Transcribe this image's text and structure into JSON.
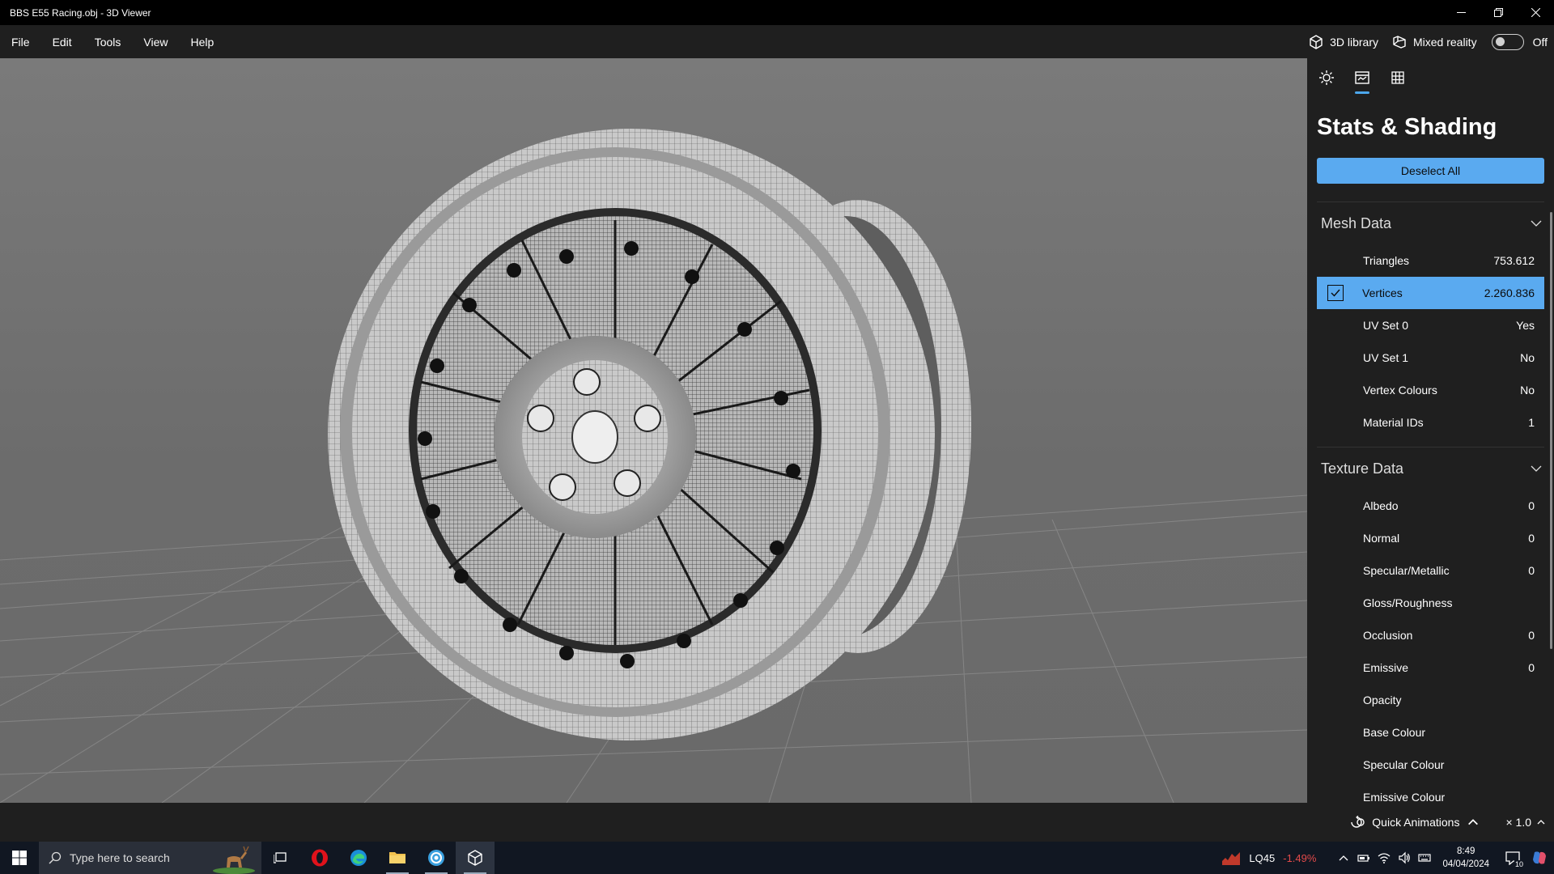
{
  "window": {
    "title": "BBS E55 Racing.obj - 3D Viewer",
    "minimize_icon": "minimize-icon",
    "restore_icon": "restore-icon",
    "close_icon": "close-icon"
  },
  "menu": {
    "items": [
      "File",
      "Edit",
      "Tools",
      "View",
      "Help"
    ],
    "library_label": "3D library",
    "mixed_reality_label": "Mixed reality",
    "toggle_state": "Off"
  },
  "panel": {
    "tabs": [
      "lighting-tab",
      "stats-shading-tab",
      "grid-tab"
    ],
    "active_tab": "stats-shading-tab",
    "title": "Stats & Shading",
    "deselect_label": "Deselect All",
    "mesh_section": {
      "title": "Mesh Data",
      "rows": [
        {
          "label": "Triangles",
          "value": "753.612",
          "selected": false
        },
        {
          "label": "Vertices",
          "value": "2.260.836",
          "selected": true
        },
        {
          "label": "UV Set 0",
          "value": "Yes",
          "selected": false
        },
        {
          "label": "UV Set 1",
          "value": "No",
          "selected": false
        },
        {
          "label": "Vertex Colours",
          "value": "No",
          "selected": false
        },
        {
          "label": "Material IDs",
          "value": "1",
          "selected": false
        }
      ]
    },
    "texture_section": {
      "title": "Texture Data",
      "rows": [
        {
          "label": "Albedo",
          "value": "0"
        },
        {
          "label": "Normal",
          "value": "0"
        },
        {
          "label": "Specular/Metallic",
          "value": "0"
        },
        {
          "label": "Gloss/Roughness",
          "value": ""
        },
        {
          "label": "Occlusion",
          "value": "0"
        },
        {
          "label": "Emissive",
          "value": "0"
        },
        {
          "label": "Opacity",
          "value": ""
        },
        {
          "label": "Base Colour",
          "value": ""
        },
        {
          "label": "Specular Colour",
          "value": ""
        },
        {
          "label": "Emissive Colour",
          "value": ""
        }
      ]
    }
  },
  "statusbar": {
    "quick_animations_label": "Quick Animations",
    "speed_label": "× 1.0"
  },
  "taskbar": {
    "search_placeholder": "Type here to search",
    "stock_symbol": "LQ45",
    "stock_change": "-1.49%",
    "time": "8:49",
    "date": "04/04/2024",
    "notification_count": "10"
  },
  "colors": {
    "accent": "#5aaaf0",
    "panel_bg": "#1f1f1f",
    "viewport_bg": "#707070",
    "stock_negative": "#e24a4a"
  }
}
